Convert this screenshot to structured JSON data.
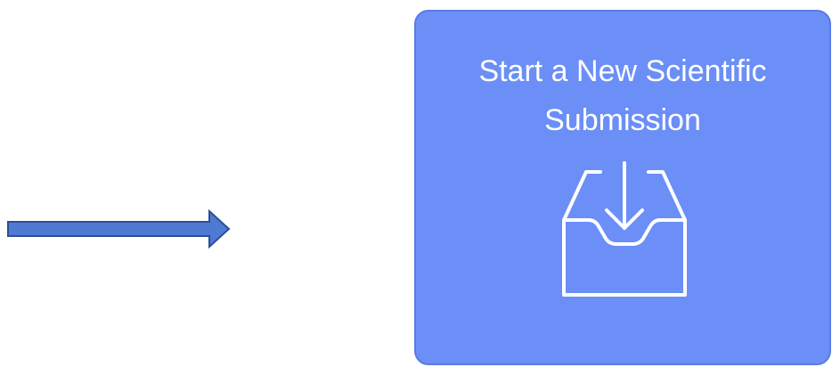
{
  "card": {
    "title": "Start a New Scientific Submission",
    "icon": "inbox-download-icon",
    "background_color": "#6b8ff7",
    "text_color": "#ffffff"
  },
  "pointer": {
    "icon": "right-arrow-icon",
    "fill_color": "#4f7ad1",
    "stroke_color": "#2e4e93"
  }
}
